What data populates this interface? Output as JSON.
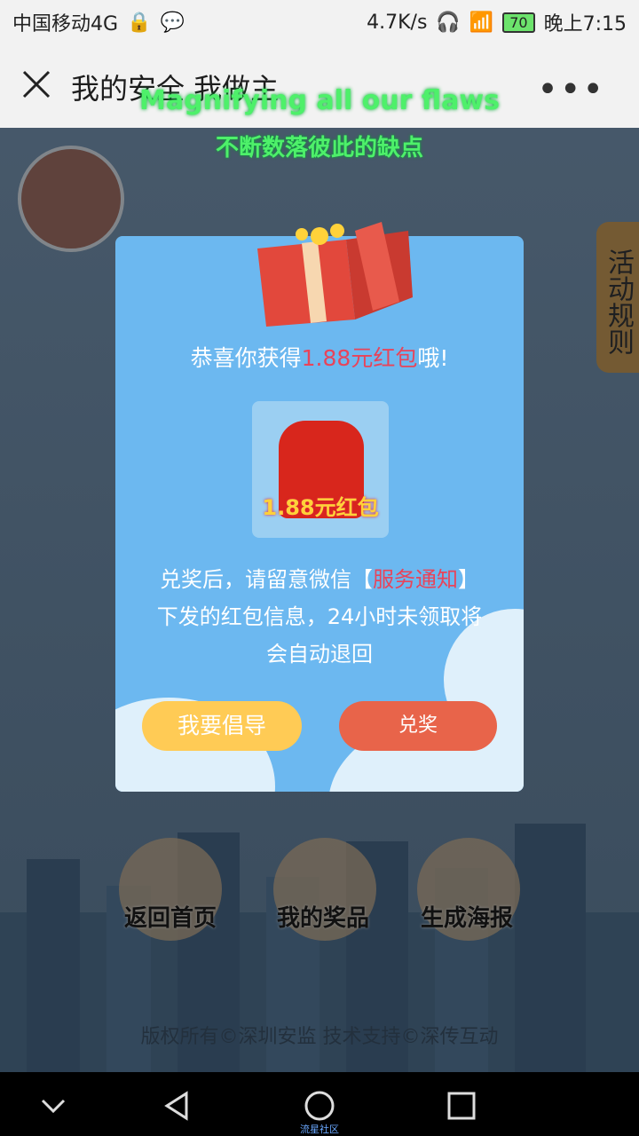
{
  "status": {
    "carrier": "中国移动4G",
    "speed": "4.7K/s",
    "battery": "70",
    "time": "晚上7:15"
  },
  "titlebar": {
    "title": "我的安全 我做主"
  },
  "overlay": {
    "caption_en": "Magnifying all our flaws",
    "caption_zh": "不断数落彼此的缺点"
  },
  "side_tab": "活动规则",
  "modal": {
    "congrats_prefix": "恭喜你获得",
    "congrats_amount": "1.88元红包",
    "congrats_suffix": "哦!",
    "prize_label": "1.88元红包",
    "notice_prefix": "兑奖后，请留意微信【",
    "notice_highlight": "服务通知",
    "notice_suffix": "】下发的红包信息，24小时未领取将会自动退回",
    "btn_promote": "我要倡导",
    "btn_redeem": "兑奖"
  },
  "bottom_nav": {
    "home": "返回首页",
    "prizes": "我的奖品",
    "poster": "生成海报"
  },
  "copyright": "版权所有©深圳安监  技术支持©深传互动",
  "nav_footer": "流星社区",
  "colors": {
    "modal_bg": "#6cb8f0",
    "highlight": "#e8445a",
    "btn_yellow": "#ffcb55",
    "btn_red": "#e8644a"
  }
}
